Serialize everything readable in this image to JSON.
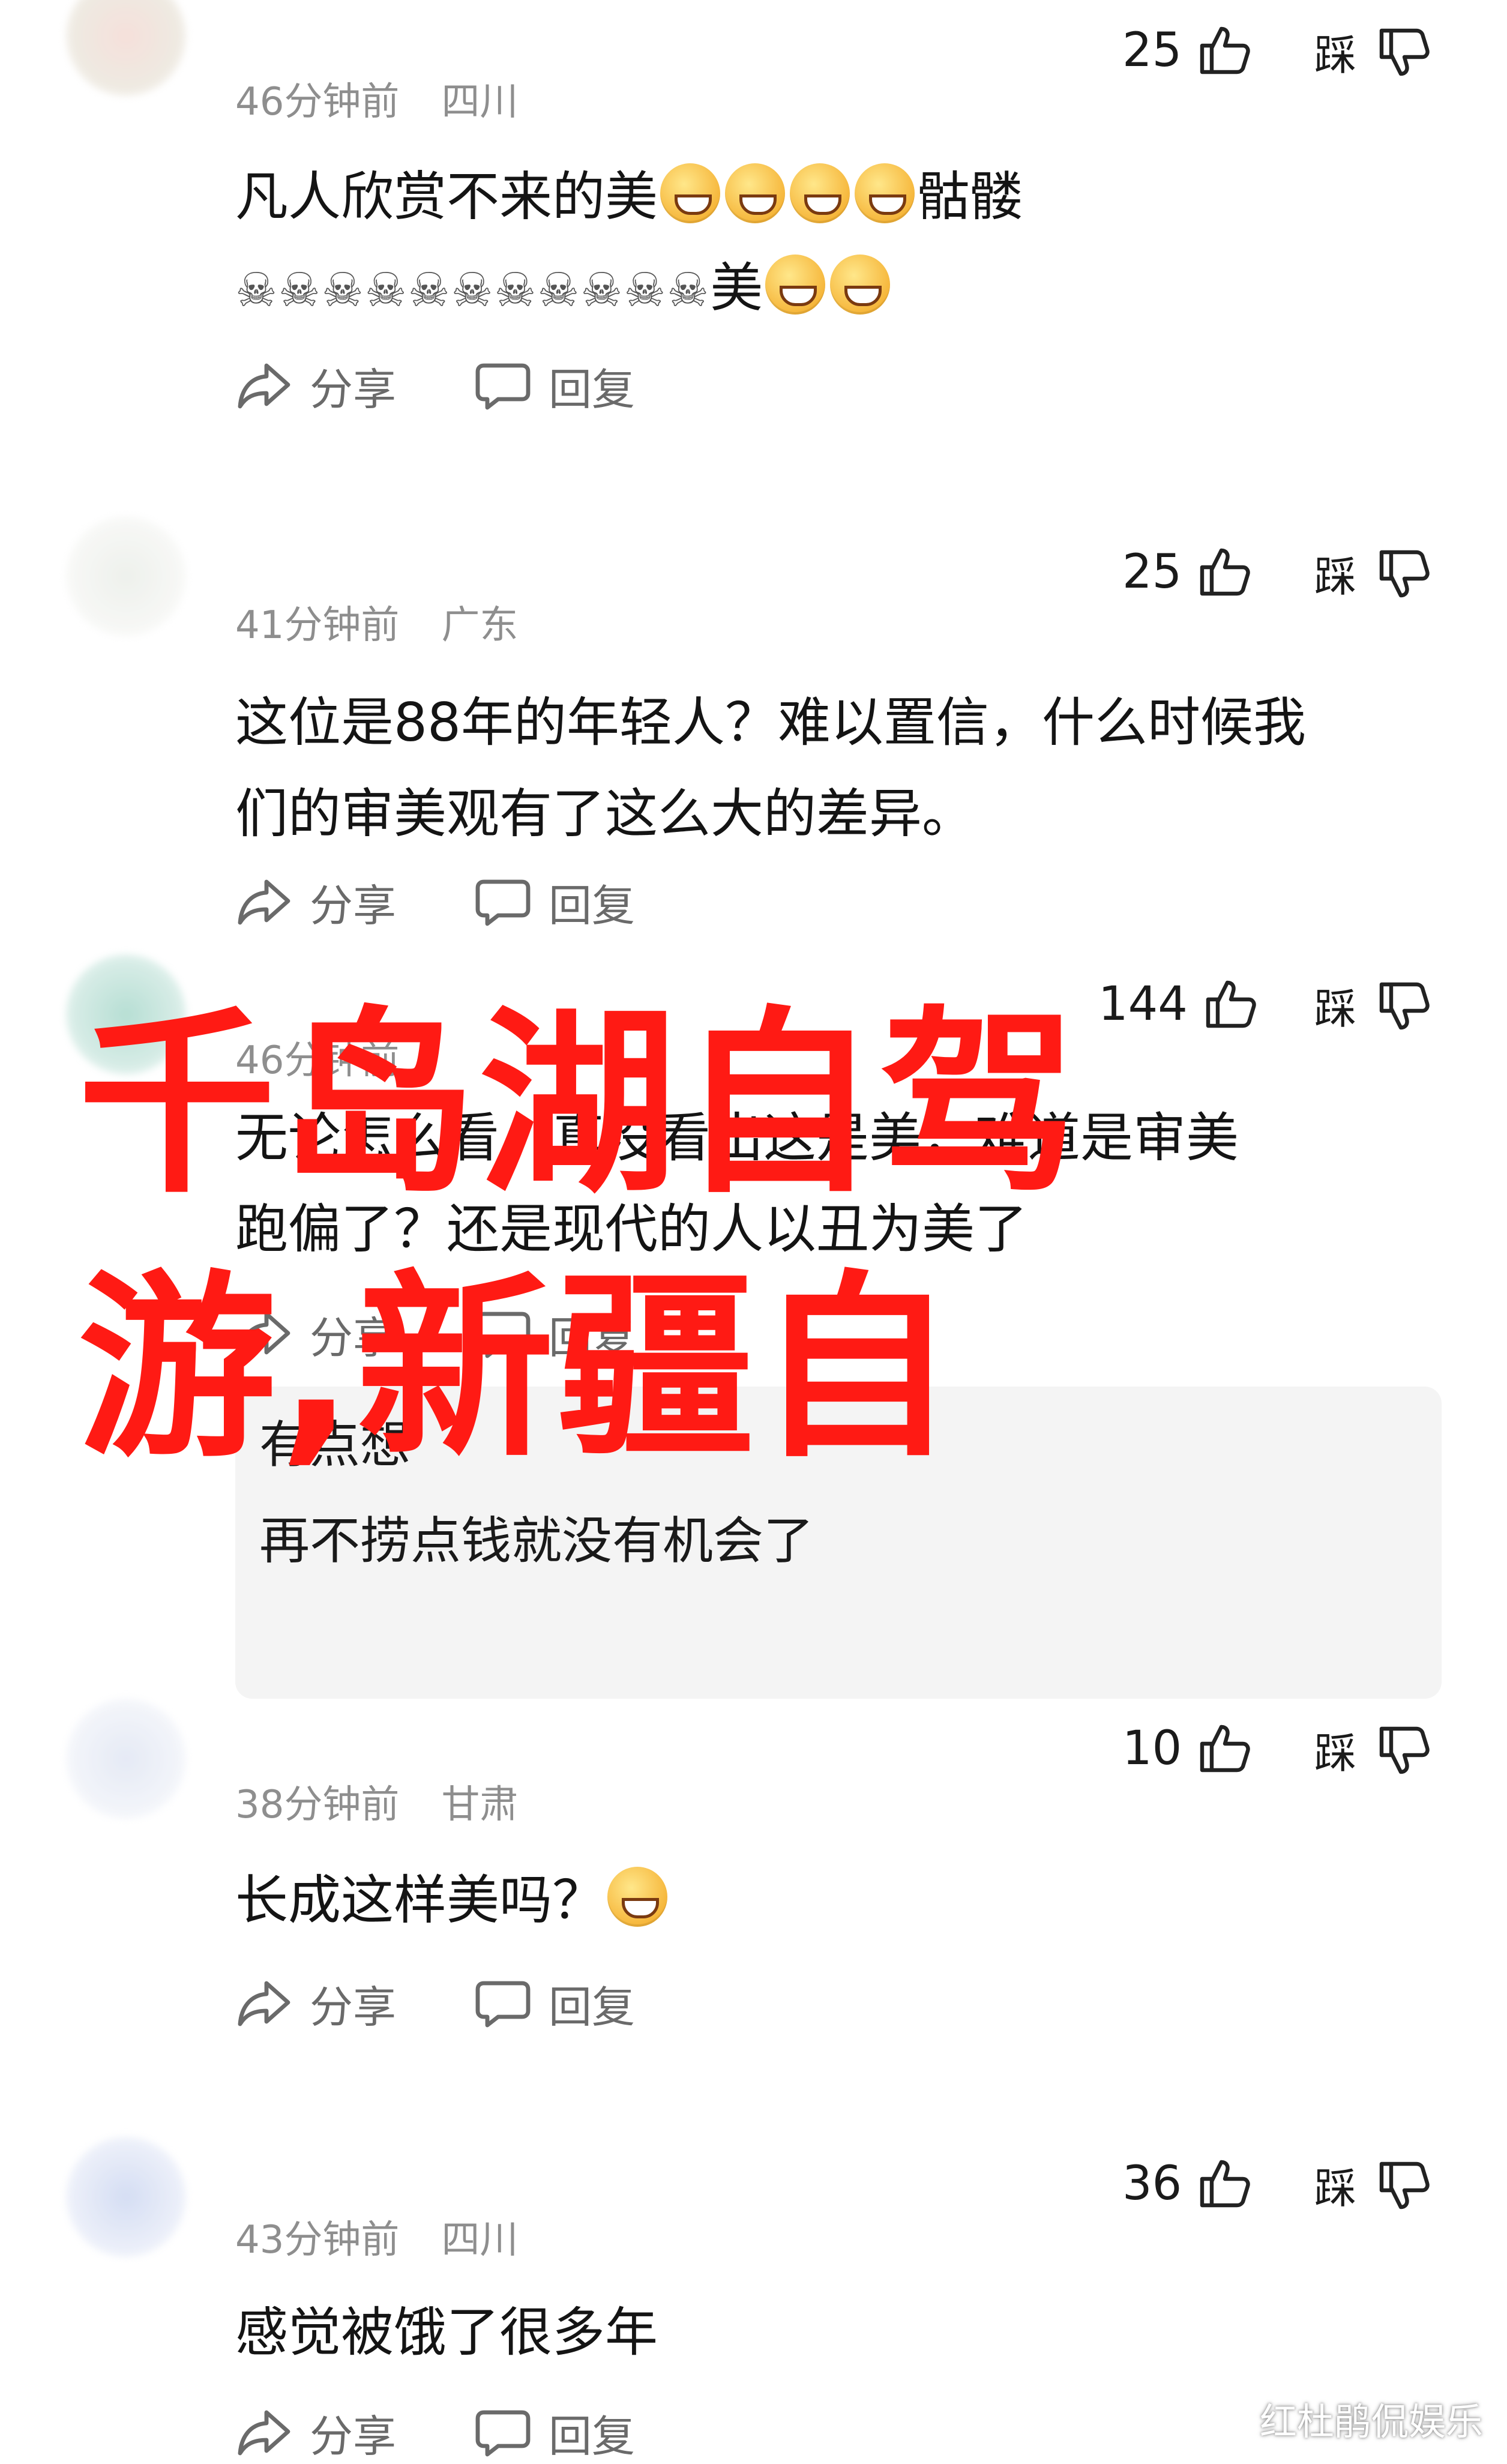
{
  "comments": [
    {
      "username": "",
      "time": "46分钟前",
      "location": "四川",
      "likes": "25",
      "dislike_label": "踩",
      "text_line1": "凡人欣赏不来的美",
      "text_line1_tail": "骷髅",
      "text_line2_skulls": "☠☠☠☠☠☠☠☠☠☠☠",
      "text_line2_tail": "美",
      "share_label": "分享",
      "reply_label": "回复"
    },
    {
      "username": "",
      "time": "41分钟前",
      "location": "广东",
      "likes": "25",
      "dislike_label": "踩",
      "text_line1": "这位是88年的年轻人？难以置信，什么时候我",
      "text_line2": "们的审美观有了这么大的差异。",
      "share_label": "分享",
      "reply_label": "回复"
    },
    {
      "username": "",
      "time": "46分钟前",
      "location": "",
      "likes": "144",
      "dislike_label": "踩",
      "text_line1": "无论怎么看，真没看出这是美，难道是审美",
      "text_line2": "跑偏了？还是现代的人以丑为美了",
      "share_label": "分享",
      "reply_label": "回复",
      "reply_preview_1": "有点想",
      "reply_preview_2": "再不捞点钱就没有机会了"
    },
    {
      "username": "",
      "time": "38分钟前",
      "location": "甘肃",
      "likes": "10",
      "dislike_label": "踩",
      "text_line1": "长成这样美吗？",
      "share_label": "分享",
      "reply_label": "回复"
    },
    {
      "username": "",
      "time": "43分钟前",
      "location": "四川",
      "likes": "36",
      "dislike_label": "踩",
      "text_line1": "感觉被饿了很多年",
      "share_label": "分享",
      "reply_label": "回复"
    }
  ],
  "overlay": {
    "line1": "千岛湖自驾",
    "line2": "游,新疆自",
    "color": "#ff1a14"
  },
  "watermark": "红杜鹃侃娱乐"
}
